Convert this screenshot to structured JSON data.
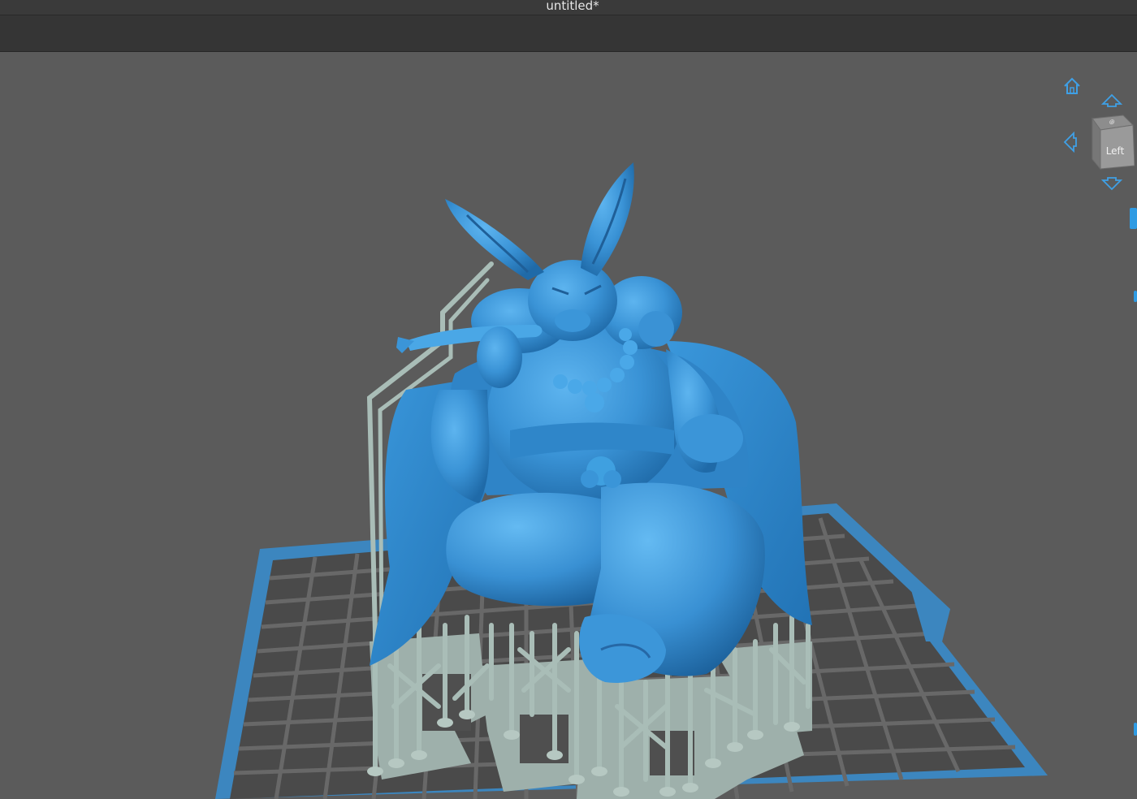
{
  "window": {
    "title": "untitled*"
  },
  "navigation": {
    "home_label": "Home view",
    "view_cube": {
      "face_label": "Left",
      "top_face_label": "Top"
    },
    "arrows": [
      "up",
      "left",
      "down"
    ]
  },
  "scene": {
    "model": "rabbit-figurine",
    "model_color": "#3a93d6",
    "support_color": "#9fb3ad",
    "build_plate_border_color": "#3c86bf",
    "build_plate_color": "#4a4a4a",
    "grid_color": "#666666",
    "background_color": "#5b5b5b"
  },
  "colors": {
    "accent": "#2f9be3",
    "titlebar_bg": "#3a3a3a",
    "toolbar_bg": "#353535"
  }
}
